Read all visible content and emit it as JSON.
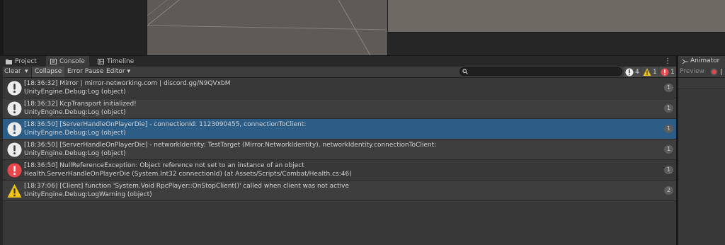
{
  "tabs": [
    {
      "label": "Project",
      "icon": "folder-icon"
    },
    {
      "label": "Console",
      "icon": "console-icon"
    },
    {
      "label": "Timeline",
      "icon": "timeline-icon"
    }
  ],
  "toolbar": {
    "clear_label": "Clear",
    "collapse_label": "Collapse",
    "error_pause_label": "Error Pause",
    "editor_label": "Editor",
    "search_placeholder": "",
    "log_count": "4",
    "warning_count": "1",
    "error_count": "1"
  },
  "animator": {
    "tab_label": "Animator",
    "preview_label": "Preview"
  },
  "logs": [
    {
      "type": "info",
      "line1": "[18:36:32] Mirror | mirror-networking.com | discord.gg/N9QVxbM",
      "line2": "UnityEngine.Debug:Log (object)",
      "count": "1"
    },
    {
      "type": "info",
      "line1": "[18:36:32] KcpTransport initialized!",
      "line2": "UnityEngine.Debug:Log (object)",
      "count": "1"
    },
    {
      "type": "info",
      "line1": "[18:36:50] [ServerHandleOnPlayerDie] - connectionId: 1123090455, connectionToClient:",
      "line2": "UnityEngine.Debug:Log (object)",
      "count": "1"
    },
    {
      "type": "info",
      "line1": "[18:36:50] [ServerHandleOnPlayerDie] - networkIdentity: TestTarget (Mirror.NetworkIdentity), networkIdentity.connectionToClient:",
      "line2": "UnityEngine.Debug:Log (object)",
      "count": "1"
    },
    {
      "type": "error",
      "line1": "[18:36:50] NullReferenceException: Object reference not set to an instance of an object",
      "line2": "Health.ServerHandleOnPlayerDie (System.Int32 connectionId) (at Assets/Scripts/Combat/Health.cs:46)",
      "count": "1"
    },
    {
      "type": "warning",
      "line1": "[18:37:06] [Client] function 'System.Void RpcPlayer::OnStopClient()' called when client was not active",
      "line2": "UnityEngine.Debug:LogWarning (object)",
      "count": "2"
    }
  ],
  "colors": {
    "selection": "#2c5d87",
    "error": "#e8474c",
    "warning": "#f0c419",
    "info": "#ececec"
  }
}
